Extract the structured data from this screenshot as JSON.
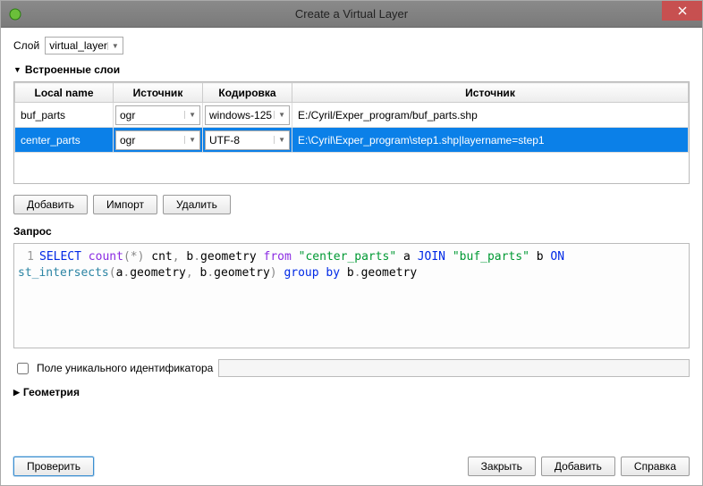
{
  "window": {
    "title": "Create a Virtual Layer"
  },
  "layer": {
    "label": "Слой",
    "value": "virtual_layer"
  },
  "embedded": {
    "title": "Встроенные слои",
    "columns": [
      "Local name",
      "Источник",
      "Кодировка",
      "Источник"
    ],
    "rows": [
      {
        "local": "buf_parts",
        "src1": "ogr",
        "enc": "windows-125",
        "path": "E:/Cyril/Exper_program/buf_parts.shp",
        "selected": false
      },
      {
        "local": "center_parts",
        "src1": "ogr",
        "enc": "UTF-8",
        "path": "E:\\Cyril\\Exper_program\\step1.shp|layername=step1",
        "selected": true
      }
    ],
    "buttons": {
      "add": "Добавить",
      "import": "Импорт",
      "delete": "Удалить"
    }
  },
  "query": {
    "label": "Запрос",
    "lineno": "1",
    "tokens": {
      "t1": "SELECT",
      "t2": "count",
      "t3": "(",
      "t4": "*",
      "t5": ")",
      "t6": " cnt",
      "t7": ",",
      "t8": " b",
      "t9": ".",
      "t10": "geometry ",
      "t11": "from",
      "t12": " ",
      "t13": "\"center_parts\"",
      "t14": " a ",
      "t15": "JOIN",
      "t16": " ",
      "t17": "\"buf_parts\"",
      "t18": " b ",
      "t19": "ON",
      "t20": " st_intersects",
      "t21": "(",
      "t22": "a",
      "t23": ".",
      "t24": "geometry",
      "t25": ",",
      "t26": " b",
      "t27": ".",
      "t28": "geometry",
      "t29": ")",
      "t30": " ",
      "t31": "group",
      "t32": " ",
      "t33": "by",
      "t34": " b",
      "t35": ".",
      "t36": "geometry"
    }
  },
  "uid": {
    "label": "Поле уникального идентификатора"
  },
  "geometry": {
    "title": "Геометрия"
  },
  "bottom": {
    "check": "Проверить",
    "close": "Закрыть",
    "add": "Добавить",
    "help": "Справка"
  }
}
